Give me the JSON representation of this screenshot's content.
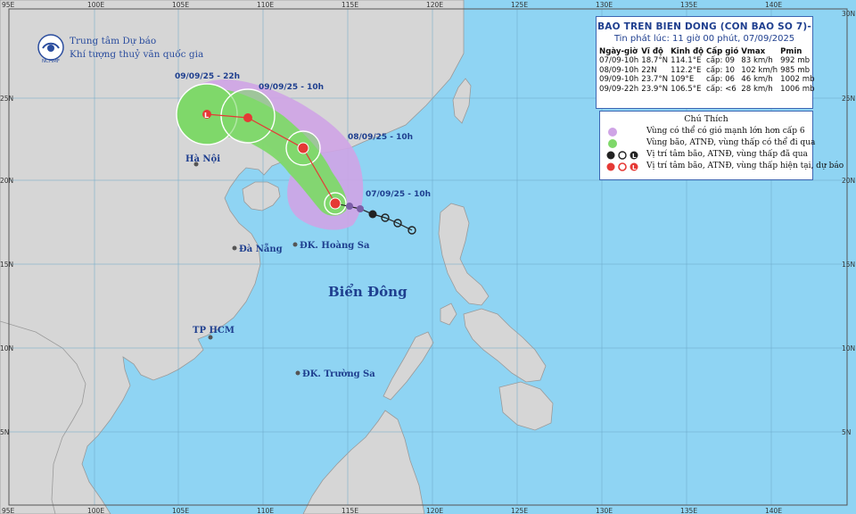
{
  "organization": {
    "line1": "Trung tâm Dự báo",
    "line2": "Khí tượng thuỷ văn quốc gia",
    "logo_text": "NCHMF"
  },
  "bulletin": {
    "title": "BAO TREN BIEN DONG (CON BAO SO 7)-",
    "issued": "Tin phát lúc: 11 giờ 00 phút, 07/09/2025",
    "columns": [
      "Ngày-giờ",
      "Vĩ độ",
      "Kinh độ",
      "Cấp gió",
      "Vmax",
      "Pmin"
    ],
    "rows": [
      [
        "07/09-10h",
        "18.7°N",
        "114.1°E",
        "cấp: 09",
        "83 km/h",
        "992 mb"
      ],
      [
        "08/09-10h",
        "22N",
        "112.2°E",
        "cấp: 10",
        "102 km/h",
        "985 mb"
      ],
      [
        "09/09-10h",
        "23.7°N",
        "109°E",
        "cấp: 06",
        "46 km/h",
        "1002 mb"
      ],
      [
        "09/09-22h",
        "23.9°N",
        "106.5°E",
        "cấp: <6",
        "28 km/h",
        "1006 mb"
      ]
    ]
  },
  "legend": {
    "title": "Chú Thích",
    "items": [
      "Vùng có thể có gió mạnh lớn hơn cấp 6",
      "Vùng bão, ATNĐ, vùng thấp có thể đi qua",
      "Vị trí tâm bão, ATNĐ, vùng thấp đã qua",
      "Vị trí tâm bão, ATNĐ, vùng thấp hiện tại, dự báo"
    ]
  },
  "axes": {
    "top": [
      "95E",
      "100E",
      "105E",
      "110E",
      "115E",
      "120E",
      "125E",
      "130E",
      "135E",
      "140E"
    ],
    "bottom": [
      "95E",
      "100E",
      "105E",
      "110E",
      "115E",
      "120E",
      "125E",
      "130E",
      "135E",
      "140E"
    ],
    "left": [
      "25N",
      "20N",
      "15N",
      "10N",
      "5N"
    ],
    "right": [
      "30N",
      "25N",
      "20N",
      "15N",
      "10N",
      "5N"
    ]
  },
  "labels": {
    "hanoi": "Hà Nội",
    "danang": "Đà Nẵng",
    "hcm": "TP HCM",
    "hoangsa": "ĐK. Hoàng Sa",
    "truongsa": "ĐK. Trường Sa",
    "sea": "Biển Đông"
  },
  "track_labels": {
    "t0": "07/09/25 - 10h",
    "t1": "08/09/25 - 10h",
    "t2": "09/09/25 - 10h",
    "t3": "09/09/25 - 22h"
  },
  "colors": {
    "sea": "#8fd4f3",
    "land": "#d6d6d6",
    "wind_zone": "#cfa4e6",
    "storm_zone": "#7fd86a",
    "track_red": "#e53935",
    "panel_border": "#3d67b3",
    "title_blue": "#1f3f8f"
  }
}
